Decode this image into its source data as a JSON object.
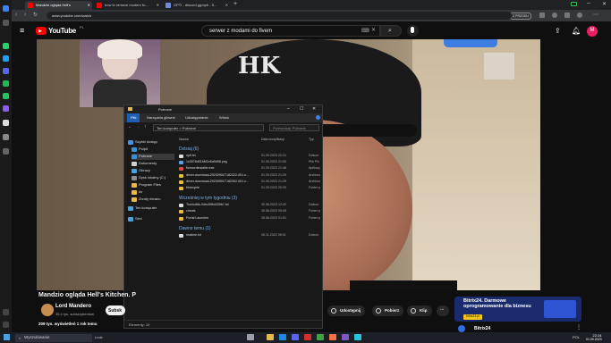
{
  "browser": {
    "tabs": [
      {
        "label": "Mandzio ogląda Hell's",
        "active": true
      },
      {
        "label": "how to remove modern fo..."
      },
      {
        "label": "OPTI - discord.gg/opti - S..."
      }
    ],
    "new_tab": "+",
    "url": "www.youtube.com/watch",
    "profile_badge": "Z PRZODU"
  },
  "youtube": {
    "logo": "YouTube",
    "region": "PL",
    "search_value": "serwer z modami do fivem",
    "avatar_letter": "M",
    "video_title": "Mandzio ogląda Hell's Kitchen. P",
    "channel_name": "Lord Mandero",
    "channel_subs": "35,4 tys. subskrybentów",
    "subscribe": "Subsk",
    "share": "Udostępnij",
    "download": "Pobierz",
    "clip": "Klip",
    "views": "209 tys. wyświetleń  1 rok temu",
    "ad_title": "Bitrix24. Darmowe oprogramowanie dla biznesu",
    "ad_cta": "bitrix24.pl",
    "ad_brand": "Bitrix24",
    "cap_text": "HK"
  },
  "explorer": {
    "title": "Pobrane",
    "ribbon_tabs": [
      "Plik",
      "Narzędzia główne",
      "Udostępnianie",
      "Widok"
    ],
    "breadcrumb": "Ten komputer  >  Pobrane",
    "search_placeholder": "Przeszukaj: Pobrane",
    "nav": [
      {
        "label": "Szybki dostęp",
        "color": "#4a8fe0"
      },
      {
        "label": "Pulpit",
        "color": "#3b8fd4"
      },
      {
        "label": "Pobrane",
        "color": "#3b8fd4",
        "selected": true
      },
      {
        "label": "Dokumenty",
        "color": "#cfcfcf"
      },
      {
        "label": "Obrazy",
        "color": "#4aa3df"
      },
      {
        "label": "Dysk lokalny (C:)",
        "color": "#8d8d8d"
      },
      {
        "label": "Program Files",
        "color": "#e8b84a"
      },
      {
        "label": "dx",
        "color": "#e8b84a"
      },
      {
        "label": "Zrzuty ekranu",
        "color": "#e8b84a"
      },
      {
        "label": "Ten komputer",
        "color": "#4aa3df"
      },
      {
        "label": "Sieć",
        "color": "#4aa3df"
      }
    ],
    "columns": {
      "name": "Nazwa",
      "date": "Data modyfikacji",
      "type": "Typ"
    },
    "groups": [
      {
        "label": "Dzisiaj (6)",
        "files": [
          {
            "name": "opti.txt",
            "date": "01.09.2023 22:21",
            "type": "Dokum",
            "color": "#dddddd"
          },
          {
            "name": "1c0578d016M1e6d9d98.png",
            "date": "01.09.2023 21:50",
            "type": "Plik PN",
            "color": "#5aa0e0"
          },
          {
            "name": "fivecordinstaller.exe",
            "date": "01.09.2023 21:48",
            "type": "Aplikacj",
            "color": "#d04a4a"
          },
          {
            "name": "driver-download-20230901T182322-001.z...",
            "date": "01.09.2023 21:29",
            "type": "Archiwu",
            "color": "#e0c040"
          },
          {
            "name": "driver-download-20230901T182302-001.z...",
            "date": "01.09.2023 21:29",
            "type": "Archiwu",
            "color": "#e0c040"
          },
          {
            "name": "timecycle",
            "date": "01.09.2023 20:20",
            "type": "Folder p",
            "color": "#e8b84a"
          }
        ]
      },
      {
        "label": "Wcześniej w tym tygodniu (3)",
        "files": [
          {
            "name": "TronicAlts-94ec59b4439b7.txt",
            "date": "30.08.2023 12:42",
            "type": "Dokum",
            "color": "#dddddd"
          },
          {
            "name": "cheats",
            "date": "30.08.2023 09:09",
            "type": "Folder p",
            "color": "#e8b84a"
          },
          {
            "name": "Portal Launcher",
            "date": "28.08.2023 01:51",
            "type": "Folder p",
            "color": "#e8b84a"
          }
        ]
      },
      {
        "label": "Dawno temu (1)",
        "files": [
          {
            "name": "readme.txt",
            "date": "06.11.2022 05:01",
            "type": "Dokum",
            "color": "#dddddd"
          }
        ]
      }
    ],
    "status": "Elementy: 10"
  },
  "taskbar": {
    "search_placeholder": "Wyszukiwanie",
    "weather": "Lndz",
    "tray": "POL",
    "time": "22:24",
    "date": "01.09.2023"
  }
}
